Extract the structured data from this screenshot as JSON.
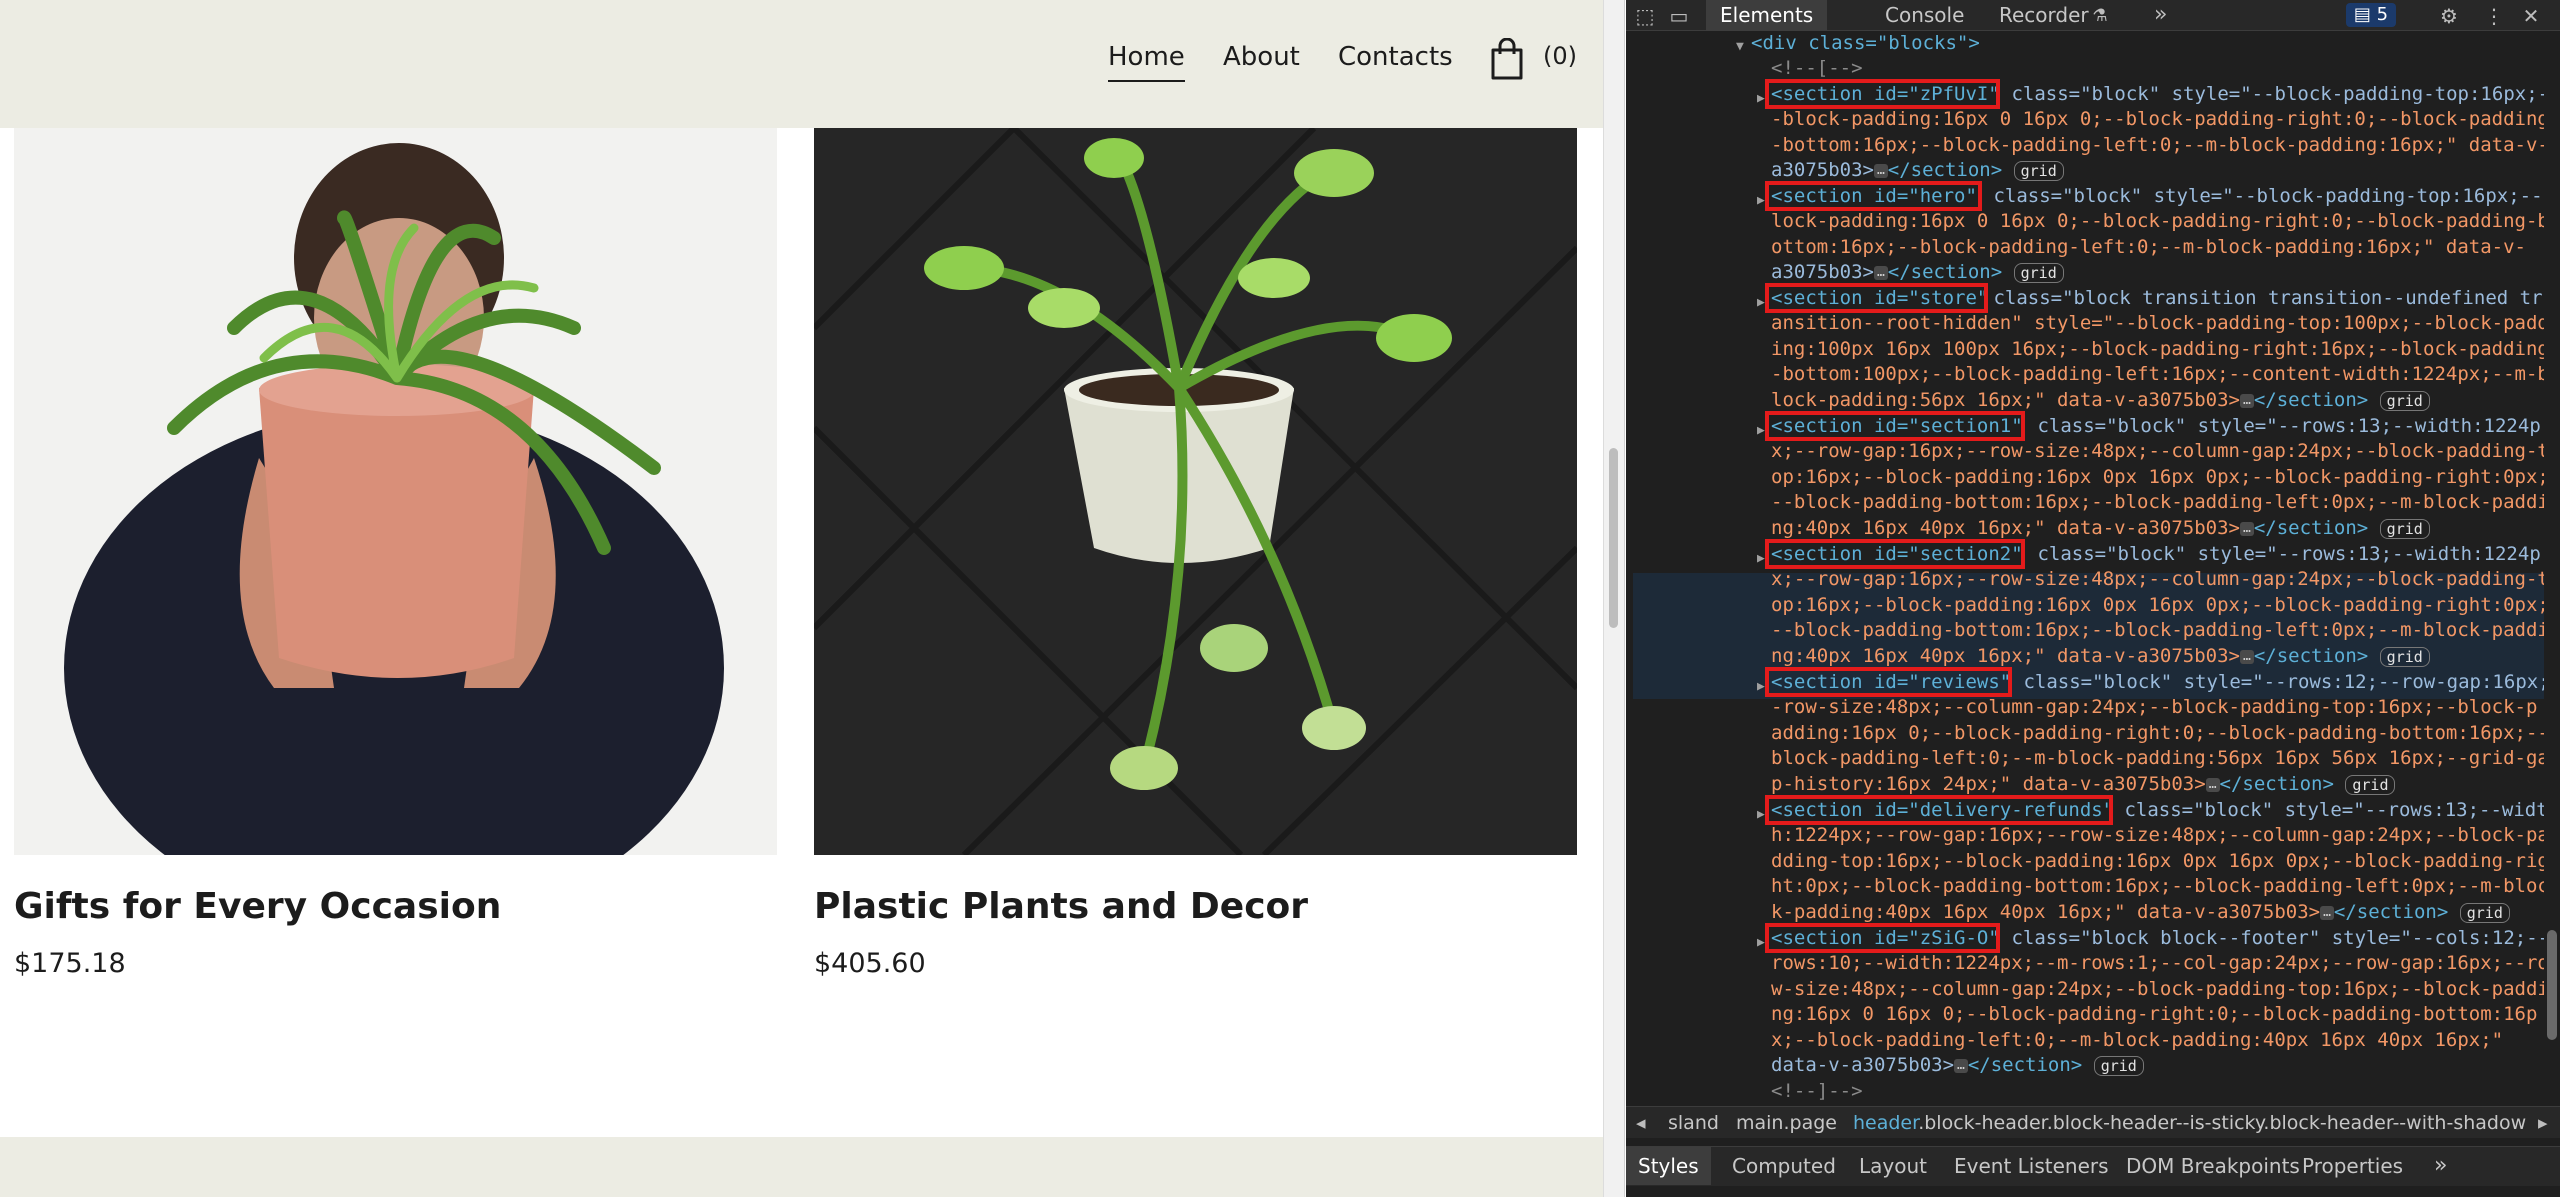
{
  "site": {
    "nav": {
      "home": "Home",
      "about": "About",
      "contacts": "Contacts"
    },
    "cart_count": "(0)",
    "products": [
      {
        "title": "Gifts for Every Occasion",
        "price": "$175.18"
      },
      {
        "title": "Plastic Plants and Decor",
        "price": "$405.60"
      }
    ]
  },
  "devtools": {
    "tabs": {
      "elements": "Elements",
      "console": "Console",
      "recorder": "Recorder"
    },
    "issues_count": "5",
    "dom_lines": {
      "l0": "<div class=\"blocks\">",
      "l1": "<!--[-->",
      "s1a": "<section id=\"zPfUvI\"",
      "s1b": " class=\"block\" style=\"--block-padding-top:16px;--",
      "s1c": "-block-padding:16px 0 16px 0;--block-padding-right:0;--block-padding",
      "s1d": "-bottom:16px;--block-padding-left:0;--m-block-padding:16px;\" data-v-",
      "s1e": "a3075b03>",
      "s2a": "<section id=\"hero\"",
      "s2b": " class=\"block\" style=\"--block-padding-top:16px;--b",
      "s2c": "lock-padding:16px 0 16px 0;--block-padding-right:0;--block-padding-b",
      "s2d": "ottom:16px;--block-padding-left:0;--m-block-padding:16px;\" data-v-",
      "s2e": "a3075b03>",
      "s3a": "<section id=\"store\"",
      "s3b": " class=\"block transition transition--undefined tr",
      "s3c": "ansition--root-hidden\" style=\"--block-padding-top:100px;--block-padd",
      "s3d": "ing:100px 16px 100px 16px;--block-padding-right:16px;--block-padding",
      "s3e": "-bottom:100px;--block-padding-left:16px;--content-width:1224px;--m-b",
      "s3f": "lock-padding:56px 16px;\" data-v-a3075b03>",
      "s4a": "<section id=\"section1\"",
      "s4b": " class=\"block\" style=\"--rows:13;--width:1224p",
      "s4c": "x;--row-gap:16px;--row-size:48px;--column-gap:24px;--block-padding-t",
      "s4d": "op:16px;--block-padding:16px 0px 16px 0px;--block-padding-right:0px;",
      "s4e": "--block-padding-bottom:16px;--block-padding-left:0px;--m-block-paddi",
      "s4f": "ng:40px 16px 40px 16px;\" data-v-a3075b03>",
      "s5a": "<section id=\"section2\"",
      "s5b": " class=\"block\" style=\"--rows:13;--width:1224p",
      "s5c": "x;--row-gap:16px;--row-size:48px;--column-gap:24px;--block-padding-t",
      "s5d": "op:16px;--block-padding:16px 0px 16px 0px;--block-padding-right:0px;",
      "s5e": "--block-padding-bottom:16px;--block-padding-left:0px;--m-block-paddi",
      "s5f": "ng:40px 16px 40px 16px;\" data-v-a3075b03>",
      "s6a": "<section id=\"reviews\"",
      "s6b": " class=\"block\" style=\"--rows:12;--row-gap:16px;-",
      "s6c": "-row-size:48px;--column-gap:24px;--block-padding-top:16px;--block-p",
      "s6d": "adding:16px 0;--block-padding-right:0;--block-padding-bottom:16px;--",
      "s6e": "block-padding-left:0;--m-block-padding:56px 16px 56px 16px;--grid-ga",
      "s6f": "p-history:16px 24px;\" data-v-a3075b03>",
      "s7a": "<section id=\"delivery-refunds\"",
      "s7b": " class=\"block\" style=\"--rows:13;--widt",
      "s7c": "h:1224px;--row-gap:16px;--row-size:48px;--column-gap:24px;--block-pa",
      "s7d": "dding-top:16px;--block-padding:16px 0px 16px 0px;--block-padding-rig",
      "s7e": "ht:0px;--block-padding-bottom:16px;--block-padding-left:0px;--m-bloc",
      "s7f": "k-padding:40px 16px 40px 16px;\" data-v-a3075b03>",
      "s8a": "<section id=\"zSiG-O\"",
      "s8b": " class=\"block block--footer\" style=\"--cols:12;--",
      "s8c": "rows:10;--width:1224px;--m-rows:1;--col-gap:24px;--row-gap:16px;--ro",
      "s8d": "w-size:48px;--column-gap:24px;--block-padding-top:16px;--block-paddi",
      "s8e": "ng:16px 0 16px 0;--block-padding-right:0;--block-padding-bottom:16p",
      "s8f": "x;--block-padding-left:0;--m-block-padding:40px 16px 40px 16px;\"",
      "s8g": "data-v-a3075b03>",
      "close": "</section>",
      "grid": "grid",
      "ellipsis": "…",
      "end": "<!--]-->"
    },
    "breadcrumb": {
      "c1": "sland",
      "c2": "main.page",
      "c3_tag": "header",
      "c3_rest": ".block-header.block-header--is-sticky.block-header--with-shadow"
    },
    "subtabs": {
      "styles": "Styles",
      "computed": "Computed",
      "layout": "Layout",
      "listeners": "Event Listeners",
      "dom_bp": "DOM Breakpoints",
      "properties": "Properties"
    }
  }
}
